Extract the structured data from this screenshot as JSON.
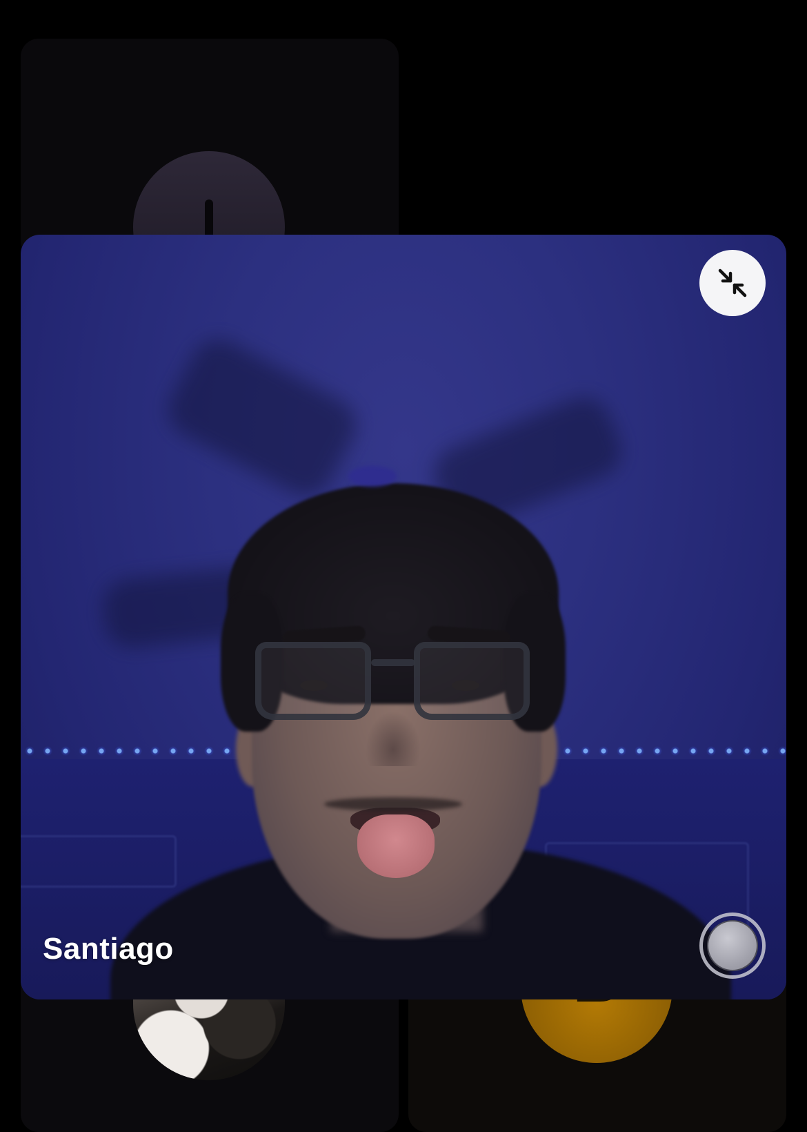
{
  "call": {
    "active_participant": {
      "name": "Santiago"
    },
    "controls": {
      "minimize_icon": "arrows-collapse-icon",
      "reaction_icon": "shutter-ring-icon"
    },
    "background_tiles": [
      {
        "type": "letter-avatar",
        "letter": ""
      },
      {
        "type": "photo-avatar"
      },
      {
        "type": "letter-avatar",
        "letter": "B",
        "color": "#b37a05"
      }
    ]
  }
}
